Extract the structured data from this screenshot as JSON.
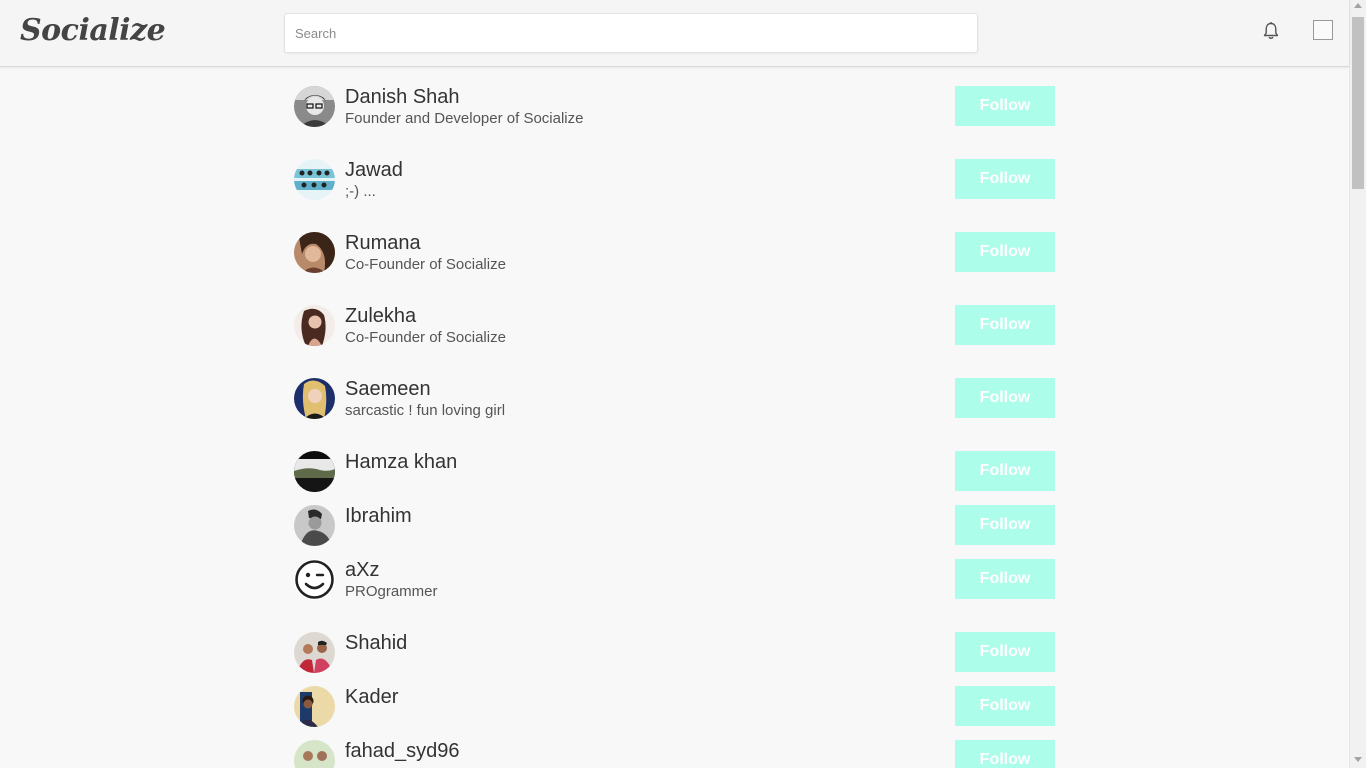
{
  "app": {
    "logo": "Socialize",
    "search_placeholder": "Search",
    "bell_icon": "bell-icon",
    "accent": "#adfdeb"
  },
  "users": [
    {
      "name": "Danish Shah",
      "bio": "Founder and Developer of Socialize",
      "follow_label": "Follow",
      "avatar": "photo-glasses-man"
    },
    {
      "name": "Jawad",
      "bio": ";-) ...",
      "follow_label": "Follow",
      "avatar": "photo-group"
    },
    {
      "name": "Rumana",
      "bio": "Co-Founder of Socialize",
      "follow_label": "Follow",
      "avatar": "photo-woman-dark"
    },
    {
      "name": "Zulekha",
      "bio": "Co-Founder of Socialize",
      "follow_label": "Follow",
      "avatar": "photo-woman-light"
    },
    {
      "name": "Saemeen",
      "bio": "sarcastic ! fun loving girl",
      "follow_label": "Follow",
      "avatar": "photo-woman-blonde"
    },
    {
      "name": "Hamza khan",
      "bio": "",
      "follow_label": "Follow",
      "avatar": "photo-landscape"
    },
    {
      "name": "Ibrahim",
      "bio": "",
      "follow_label": "Follow",
      "avatar": "photo-man-bw"
    },
    {
      "name": "aXz",
      "bio": "PROgrammer",
      "follow_label": "Follow",
      "avatar": "wink-emoji"
    },
    {
      "name": "Shahid",
      "bio": "",
      "follow_label": "Follow",
      "avatar": "photo-two-men"
    },
    {
      "name": "Kader",
      "bio": "",
      "follow_label": "Follow",
      "avatar": "photo-man-beige"
    },
    {
      "name": "fahad_syd96",
      "bio": "",
      "follow_label": "Follow",
      "avatar": "photo-outdoor-men"
    }
  ]
}
